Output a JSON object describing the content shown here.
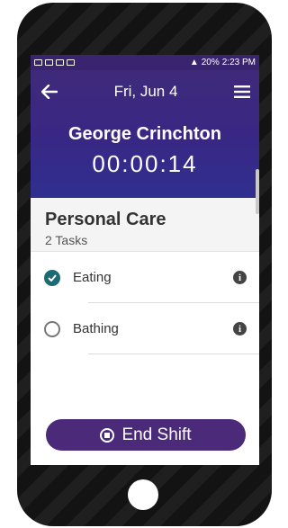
{
  "statusbar": {
    "battery": "20%",
    "time": "2:23 PM"
  },
  "header": {
    "date": "Fri, Jun 4",
    "worker_name": "George Crinchton",
    "timer": "00:00:14"
  },
  "section": {
    "title": "Personal Care",
    "subtitle": "2 Tasks"
  },
  "tasks": [
    {
      "label": "Eating",
      "done": true
    },
    {
      "label": "Bathing",
      "done": false
    }
  ],
  "actions": {
    "end_shift": "End Shift"
  },
  "colors": {
    "header": "#3f2a7a",
    "check": "#1c6a74",
    "button": "#4b2a7a"
  }
}
